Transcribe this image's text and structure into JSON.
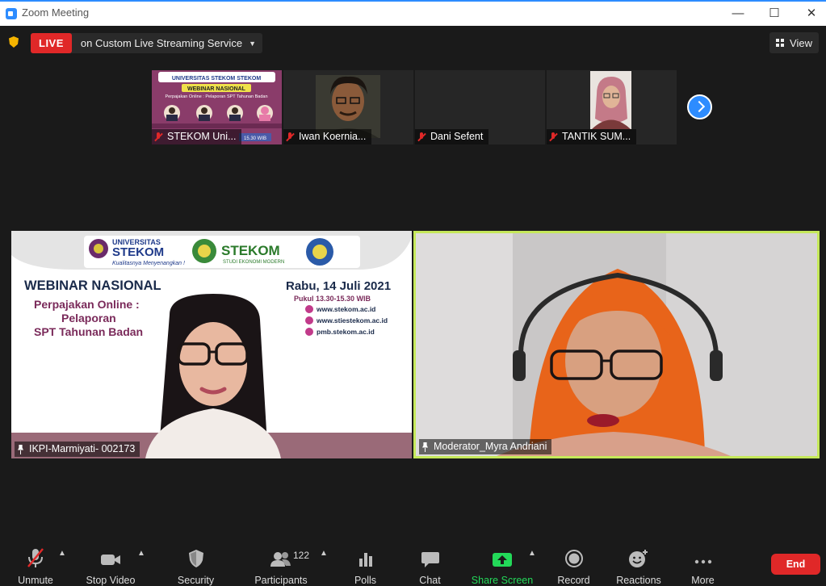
{
  "window": {
    "title": "Zoom Meeting",
    "controls": [
      "—",
      "☐",
      "✕"
    ]
  },
  "live": {
    "badge": "LIVE",
    "text": "on Custom Live Streaming Service"
  },
  "view_button": {
    "label": "View"
  },
  "thumbnails": [
    {
      "name": "STEKOM Uni...",
      "muted": true,
      "slide": {
        "logos": "UNIVERSITAS STEKOM   STEKOM",
        "heading": "WEBINAR NASIONAL",
        "subtitle": "Perpajakan Online : Pelaporan SPT Tahunan Badan",
        "time": "15.30 WIB"
      }
    },
    {
      "name": "Iwan Koernia...",
      "muted": true
    },
    {
      "name": "Dani Sefent",
      "muted": true
    },
    {
      "name": "TANTIK SUM...",
      "muted": true
    }
  ],
  "main_tiles": [
    {
      "name": "IKPI-Marmiyati- 002173",
      "pinned": true,
      "active_speaker": false,
      "background": {
        "logo_left": "UNIVERSITAS",
        "logo_left_brand": "STEKOM",
        "logo_left_tagline": "Kualitasnya Menyenangkan !",
        "logo_right_brand": "STEKOM",
        "logo_right_tagline": "STUDI EKONOMI MODERN",
        "heading": "WEBINAR NASIONAL",
        "subtitle_lines": [
          "Perpajakan Online :",
          "Pelaporan",
          "SPT Tahunan Badan"
        ],
        "date": "Rabu, 14 Juli 2021",
        "time": "Pukul 13.30-15.30 WIB",
        "links": [
          "www.stekom.ac.id",
          "www.stiestekom.ac.id",
          "pmb.stekom.ac.id"
        ]
      }
    },
    {
      "name": "Moderator_Myra Andriani",
      "pinned": true,
      "active_speaker": true
    }
  ],
  "toolbar": {
    "unmute": "Unmute",
    "stop_video": "Stop Video",
    "security": "Security",
    "participants": "Participants",
    "participants_count": "122",
    "polls": "Polls",
    "chat": "Chat",
    "share_screen": "Share Screen",
    "record": "Record",
    "reactions": "Reactions",
    "more": "More",
    "end": "End"
  },
  "colors": {
    "accent": "#2d8cff",
    "live": "#e02828",
    "share": "#23d959",
    "active_border": "#c5e85a"
  }
}
